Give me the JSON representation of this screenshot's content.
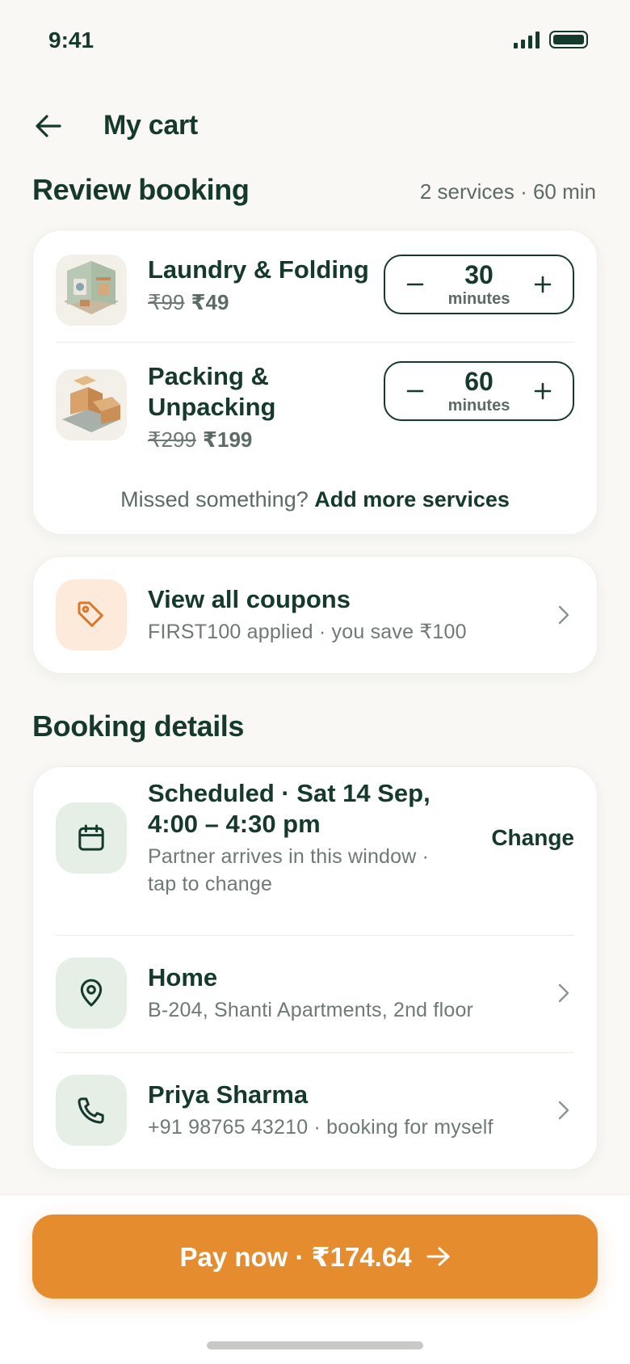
{
  "status_bar": {
    "time": "9:41"
  },
  "header": {
    "title": "My cart"
  },
  "review": {
    "title": "Review booking",
    "meta": "2 services · 60 min",
    "services": [
      {
        "name": "Laundry & Folding",
        "old_price": "₹99",
        "price": "₹49",
        "amount": "30",
        "unit": "minutes"
      },
      {
        "name": "Packing & Unpacking",
        "old_price": "₹299",
        "price": "₹199",
        "amount": "60",
        "unit": "minutes"
      }
    ],
    "add_more_prefix": "Missed something?",
    "add_more_link": "Add more services"
  },
  "coupons": {
    "title": "View all coupons",
    "subtitle": "FIRST100 applied · you save ₹100"
  },
  "details": {
    "title": "Booking details",
    "schedule": {
      "title": "Scheduled · Sat 14 Sep, 4:00 – 4:30 pm",
      "subtitle": "Partner arrives in this window · tap to change",
      "action": "Change"
    },
    "address": {
      "title": "Home",
      "subtitle": "B-204, Shanti Apartments, 2nd floor"
    },
    "contact": {
      "title": "Priya Sharma",
      "subtitle": "+91 98765 43210 · booking for myself"
    }
  },
  "pay": {
    "label": "Pay now · ₹174.64"
  },
  "colors": {
    "primary": "#15392c",
    "accent": "#e58c2e",
    "background": "#f9f8f4",
    "tile_green": "#e6efe6",
    "tile_orange": "#fdeadb"
  }
}
